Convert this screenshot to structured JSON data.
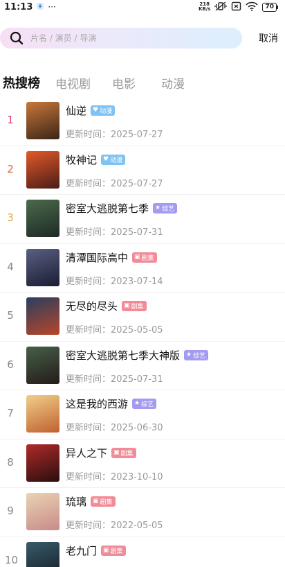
{
  "status_bar": {
    "time": "11:13",
    "dots": "···",
    "net_speed_value": "218",
    "net_speed_unit": "KB/s",
    "battery": "70"
  },
  "search": {
    "placeholder": "片名 / 演员 / 导演",
    "cancel_label": "取消"
  },
  "tabs": [
    {
      "label": "热搜榜",
      "active": true
    },
    {
      "label": "电视剧",
      "active": false
    },
    {
      "label": "电影",
      "active": false
    },
    {
      "label": "动漫",
      "active": false
    }
  ],
  "list": [
    {
      "rank": "1",
      "title": "仙逆",
      "badge": "动漫",
      "badge_type": "anime",
      "update": "更新时间：2025-07-27",
      "poster_colors": [
        "#c9783a",
        "#3a2418"
      ]
    },
    {
      "rank": "2",
      "title": "牧神记",
      "badge": "动漫",
      "badge_type": "anime",
      "update": "更新时间：2025-07-27",
      "poster_colors": [
        "#e25a2a",
        "#4a1c16"
      ]
    },
    {
      "rank": "3",
      "title": "密室大逃脱第七季",
      "badge": "综艺",
      "badge_type": "variety",
      "update": "更新时间：2025-07-31",
      "poster_colors": [
        "#4c6a4a",
        "#1c2a26"
      ]
    },
    {
      "rank": "4",
      "title": "清潭国际高中",
      "badge": "剧集",
      "badge_type": "drama",
      "update": "更新时间：2023-07-14",
      "poster_colors": [
        "#5a5f82",
        "#1c1d33"
      ]
    },
    {
      "rank": "5",
      "title": "无尽的尽头",
      "badge": "剧集",
      "badge_type": "drama",
      "update": "更新时间：2025-05-05",
      "poster_colors": [
        "#2a3f5e",
        "#b8452a"
      ]
    },
    {
      "rank": "6",
      "title": "密室大逃脱第七季大神版",
      "badge": "综艺",
      "badge_type": "variety",
      "update": "更新时间：2025-07-31",
      "poster_colors": [
        "#46604a",
        "#251a18"
      ]
    },
    {
      "rank": "7",
      "title": "这是我的西游",
      "badge": "综艺",
      "badge_type": "variety",
      "update": "更新时间：2025-06-30",
      "poster_colors": [
        "#f0cf8a",
        "#c0612e"
      ]
    },
    {
      "rank": "8",
      "title": "异人之下",
      "badge": "剧集",
      "badge_type": "drama",
      "update": "更新时间：2023-10-10",
      "poster_colors": [
        "#b02a2a",
        "#2a0e0e"
      ]
    },
    {
      "rank": "9",
      "title": "琉璃",
      "badge": "剧集",
      "badge_type": "drama",
      "update": "更新时间：2022-05-05",
      "poster_colors": [
        "#e9d4b2",
        "#c88a8a"
      ]
    },
    {
      "rank": "10",
      "title": "老九门",
      "badge": "剧集",
      "badge_type": "drama",
      "update": "",
      "poster_colors": [
        "#3a5a6a",
        "#121c24"
      ]
    }
  ],
  "colors": {
    "rank_1": "#d6427b",
    "rank_2": "#e0672f",
    "rank_3": "#e6a93a",
    "badge_anime": "#7fc2f4",
    "badge_variety": "#a29bf0",
    "badge_drama": "#f28b97"
  }
}
